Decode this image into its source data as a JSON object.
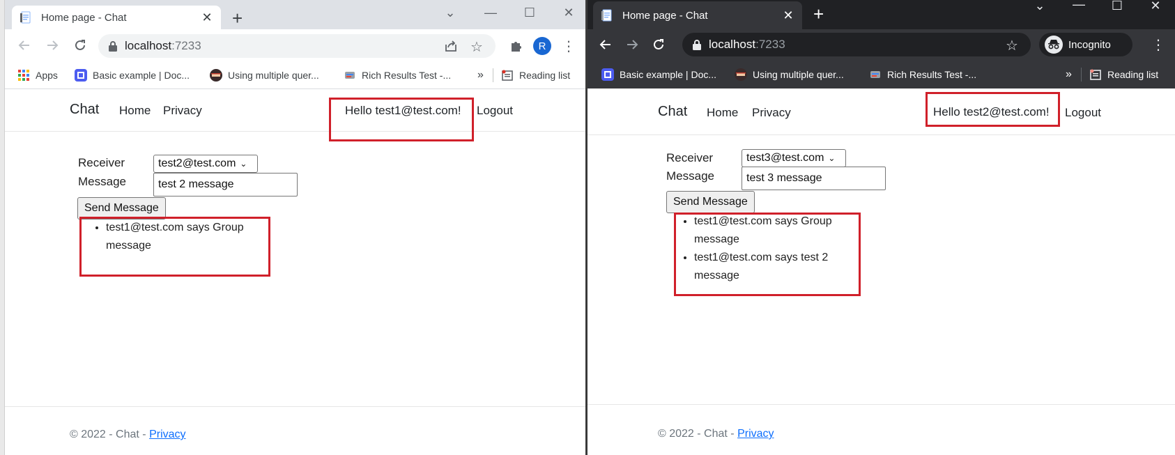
{
  "left_window": {
    "tab_title": "Home page - Chat",
    "address": {
      "host": "localhost",
      "port": ":7233"
    },
    "profile_initial": "R",
    "bookmarks": [
      "Apps",
      "Basic example | Doc...",
      "Using multiple quer...",
      "Rich Results Test -..."
    ],
    "more_bookmarks": "»",
    "reading_list": "Reading list",
    "nav": {
      "brand": "Chat",
      "home": "Home",
      "privacy": "Privacy",
      "hello": "Hello test1@test.com!",
      "logout": "Logout"
    },
    "form": {
      "receiver_label": "Receiver",
      "receiver_value": "test2@test.com",
      "message_label": "Message",
      "message_value": "test 2 message",
      "send_label": "Send Message"
    },
    "messages": [
      [
        "test1@test.com says Group",
        "message"
      ]
    ],
    "footer": {
      "copyright": "© 2022 - Chat - ",
      "privacy": "Privacy"
    }
  },
  "right_window": {
    "tab_title": "Home page - Chat",
    "address": {
      "host": "localhost",
      "port": ":7233"
    },
    "incognito_label": "Incognito",
    "bookmarks": [
      "Basic example | Doc...",
      "Using multiple quer...",
      "Rich Results Test -..."
    ],
    "more_bookmarks": "»",
    "reading_list": "Reading list",
    "nav": {
      "brand": "Chat",
      "home": "Home",
      "privacy": "Privacy",
      "hello": "Hello test2@test.com!",
      "logout": "Logout"
    },
    "form": {
      "receiver_label": "Receiver",
      "receiver_value": "test3@test.com",
      "message_label": "Message",
      "message_value": "test 3 message",
      "send_label": "Send Message"
    },
    "messages": [
      [
        "test1@test.com says Group",
        "message"
      ],
      [
        "test1@test.com says test 2",
        "message"
      ]
    ],
    "footer": {
      "copyright": "© 2022 - Chat - ",
      "privacy": "Privacy"
    }
  },
  "colors": {
    "highlight": "#d0202a",
    "link": "#0d6efd",
    "incognito_chrome": "#202124",
    "incognito_toolbar": "#35363a",
    "profile_blue": "#1967d2"
  }
}
